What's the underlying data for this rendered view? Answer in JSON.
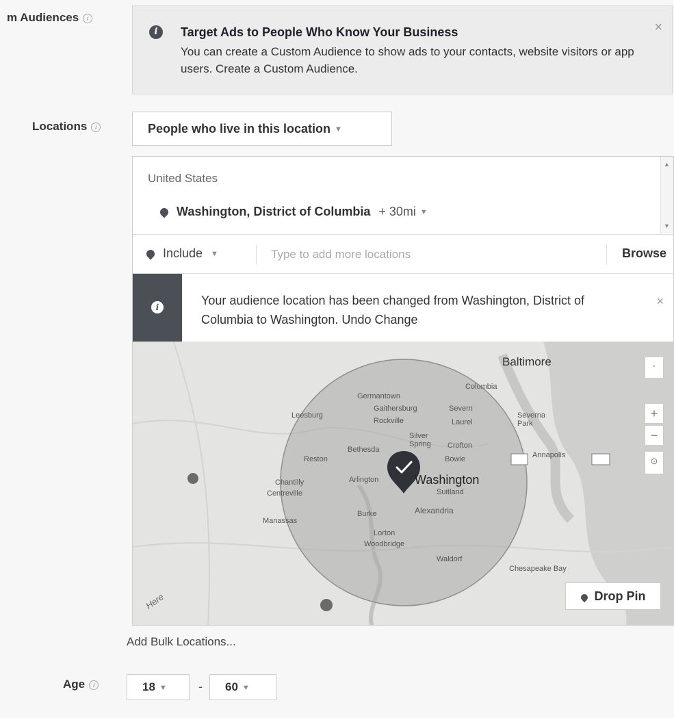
{
  "custom_audiences": {
    "label": "m Audiences",
    "tip_title": "Target Ads to People Who Know Your Business",
    "tip_body": "You can create a Custom Audience to show ads to your contacts, website visitors or app users. Create a Custom Audience.",
    "close": "×"
  },
  "locations": {
    "label": "Locations",
    "type_select": "People who live in this location",
    "country": "United States",
    "location_name": "Washington, District of Columbia",
    "radius": "+ 30mi",
    "include_label": "Include",
    "search_placeholder": "Type to add more locations",
    "browse_label": "Browse",
    "notice": "Your audience location has been changed from Washington, District of Columbia to Washington. Undo Change",
    "notice_close": "×",
    "drop_pin": "Drop Pin",
    "bulk": "Add Bulk Locations..."
  },
  "map": {
    "labels": {
      "baltimore": "Baltimore",
      "washington": "Washington",
      "germantown": "Germantown",
      "gaithersburg": "Gaithersburg",
      "rockville": "Rockville",
      "silver_spring": "Silver Spring",
      "bethesda": "Bethesda",
      "reston": "Reston",
      "arlington": "Arlington",
      "alexandria": "Alexandria",
      "annapolis": "Annapolis",
      "chantilly": "Chantilly",
      "centreville": "Centreville",
      "manassas": "Manassas",
      "burke": "Burke",
      "lorton": "Lorton",
      "woodbridge": "Woodbridge",
      "waldorf": "Waldorf",
      "leesburg": "Leesburg",
      "columbia": "Columbia",
      "laurel": "Laurel",
      "crofton": "Crofton",
      "bowie": "Bowie",
      "suitland": "Suitland",
      "severn": "Severn",
      "severna_park": "Severna Park",
      "chesapeake_bay": "Chesapeake Bay",
      "here": "Here"
    },
    "zoom_in": "+",
    "zoom_out": "−"
  },
  "age": {
    "label": "Age",
    "min": "18",
    "max": "60",
    "dash": "-"
  },
  "colors": {
    "accent_dark": "#4b4f56",
    "radius_fill": "#a9a9a9"
  }
}
